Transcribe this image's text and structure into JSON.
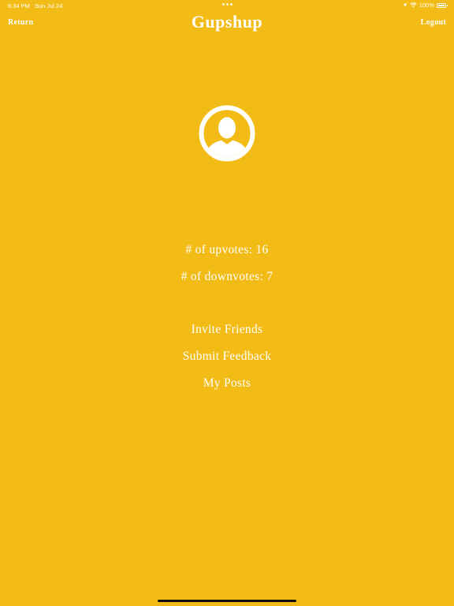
{
  "status_bar": {
    "time": "6:34 PM",
    "date": "Sun Jul 24",
    "battery": "100%",
    "icons": [
      "location-icon",
      "wifi-icon",
      "battery-icon"
    ]
  },
  "nav": {
    "left_label": "Return",
    "title": "Gupshup",
    "right_label": "Logout"
  },
  "profile": {
    "avatar_icon": "user-avatar-icon",
    "upvotes_text": "# of upvotes: 16",
    "downvotes_text": "# of downvotes: 7"
  },
  "menu": {
    "invite_label": "Invite Friends",
    "feedback_label": "Submit Feedback",
    "posts_label": "My Posts"
  },
  "colors": {
    "background": "#F2BB16",
    "text": "#FFFFFF"
  }
}
